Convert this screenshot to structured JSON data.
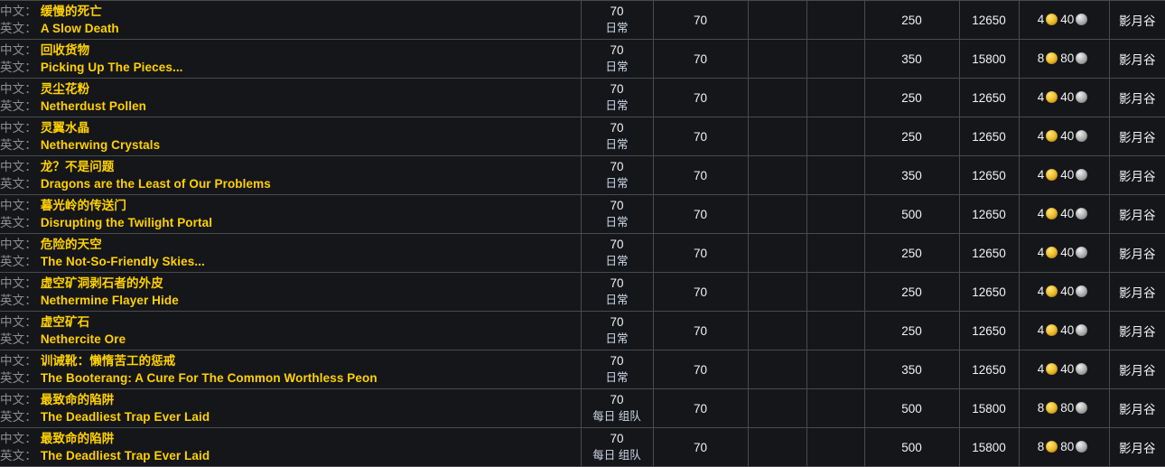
{
  "table": {
    "columns": [
      {
        "key": "name",
        "label": ""
      },
      {
        "key": "level",
        "label": ""
      },
      {
        "key": "req_level",
        "label": ""
      },
      {
        "key": "col_a",
        "label": ""
      },
      {
        "key": "col_b",
        "label": ""
      },
      {
        "key": "xp",
        "label": ""
      },
      {
        "key": "rep",
        "label": ""
      },
      {
        "key": "money",
        "label": ""
      },
      {
        "key": "zone",
        "label": ""
      }
    ],
    "labels": {
      "zh": "中文：",
      "en": "英文："
    },
    "icons": {
      "gold": "gold-coin-icon",
      "silver": "silver-coin-icon"
    },
    "colors": {
      "background": "#15161a",
      "grid": "#4a4a4a",
      "quest_name": "#ffd100",
      "label_gray": "#8d8d8d",
      "numeric": "#f2f2f2",
      "tag_blue": "#cfd8e8",
      "gold": "#f2c230",
      "silver": "#b8b8b8"
    },
    "rows": [
      {
        "name_zh": "缓慢的死亡",
        "name_en": "A Slow Death",
        "level": "70",
        "level_tag": "日常",
        "req_level": "70",
        "col_a": "",
        "col_b": "",
        "xp": "250",
        "rep": "12650",
        "money_gold": "4",
        "money_silver": "40",
        "zone": "影月谷"
      },
      {
        "name_zh": "回收货物",
        "name_en": "Picking Up The Pieces...",
        "level": "70",
        "level_tag": "日常",
        "req_level": "70",
        "col_a": "",
        "col_b": "",
        "xp": "350",
        "rep": "15800",
        "money_gold": "8",
        "money_silver": "80",
        "zone": "影月谷"
      },
      {
        "name_zh": "灵尘花粉",
        "name_en": "Netherdust Pollen",
        "level": "70",
        "level_tag": "日常",
        "req_level": "70",
        "col_a": "",
        "col_b": "",
        "xp": "250",
        "rep": "12650",
        "money_gold": "4",
        "money_silver": "40",
        "zone": "影月谷"
      },
      {
        "name_zh": "灵翼水晶",
        "name_en": "Netherwing Crystals",
        "level": "70",
        "level_tag": "日常",
        "req_level": "70",
        "col_a": "",
        "col_b": "",
        "xp": "250",
        "rep": "12650",
        "money_gold": "4",
        "money_silver": "40",
        "zone": "影月谷"
      },
      {
        "name_zh": "龙？不是问题",
        "name_en": "Dragons are the Least of Our Problems",
        "level": "70",
        "level_tag": "日常",
        "req_level": "70",
        "col_a": "",
        "col_b": "",
        "xp": "350",
        "rep": "12650",
        "money_gold": "4",
        "money_silver": "40",
        "zone": "影月谷"
      },
      {
        "name_zh": "暮光岭的传送门",
        "name_en": "Disrupting the Twilight Portal",
        "level": "70",
        "level_tag": "日常",
        "req_level": "70",
        "col_a": "",
        "col_b": "",
        "xp": "500",
        "rep": "12650",
        "money_gold": "4",
        "money_silver": "40",
        "zone": "影月谷"
      },
      {
        "name_zh": "危险的天空",
        "name_en": "The Not-So-Friendly Skies...",
        "level": "70",
        "level_tag": "日常",
        "req_level": "70",
        "col_a": "",
        "col_b": "",
        "xp": "250",
        "rep": "12650",
        "money_gold": "4",
        "money_silver": "40",
        "zone": "影月谷"
      },
      {
        "name_zh": "虚空矿洞剥石者的外皮",
        "name_en": "Nethermine Flayer Hide",
        "level": "70",
        "level_tag": "日常",
        "req_level": "70",
        "col_a": "",
        "col_b": "",
        "xp": "250",
        "rep": "12650",
        "money_gold": "4",
        "money_silver": "40",
        "zone": "影月谷"
      },
      {
        "name_zh": "虚空矿石",
        "name_en": "Nethercite Ore",
        "level": "70",
        "level_tag": "日常",
        "req_level": "70",
        "col_a": "",
        "col_b": "",
        "xp": "250",
        "rep": "12650",
        "money_gold": "4",
        "money_silver": "40",
        "zone": "影月谷"
      },
      {
        "name_zh": "训诫靴：懒惰苦工的惩戒",
        "name_en": "The Booterang: A Cure For The Common Worthless Peon",
        "level": "70",
        "level_tag": "日常",
        "req_level": "70",
        "col_a": "",
        "col_b": "",
        "xp": "350",
        "rep": "12650",
        "money_gold": "4",
        "money_silver": "40",
        "zone": "影月谷"
      },
      {
        "name_zh": "最致命的陷阱",
        "name_en": "The Deadliest Trap Ever Laid",
        "level": "70",
        "level_tag": "每日 组队",
        "req_level": "70",
        "col_a": "",
        "col_b": "",
        "xp": "500",
        "rep": "15800",
        "money_gold": "8",
        "money_silver": "80",
        "zone": "影月谷"
      },
      {
        "name_zh": "最致命的陷阱",
        "name_en": "The Deadliest Trap Ever Laid",
        "level": "70",
        "level_tag": "每日 组队",
        "req_level": "70",
        "col_a": "",
        "col_b": "",
        "xp": "500",
        "rep": "15800",
        "money_gold": "8",
        "money_silver": "80",
        "zone": "影月谷"
      }
    ]
  }
}
